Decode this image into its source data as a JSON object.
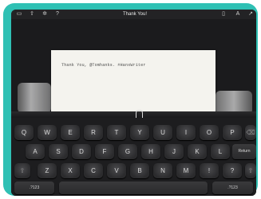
{
  "title": "Thank You!",
  "toolbar": {
    "left_icons": [
      "document-icon",
      "share-icon",
      "gear-icon",
      "help-icon"
    ],
    "right_icons": [
      "clipboard-icon",
      "font-icon",
      "export-icon"
    ]
  },
  "paper": {
    "text": "Thank You, @Tomhanks. #HanxWriter"
  },
  "keyboard": {
    "row1": [
      "Q",
      "W",
      "E",
      "R",
      "T",
      "Y",
      "U",
      "I",
      "O",
      "P"
    ],
    "row2": [
      "A",
      "S",
      "D",
      "F",
      "G",
      "H",
      "J",
      "K",
      "L"
    ],
    "row3": [
      "Z",
      "X",
      "C",
      "V",
      "B",
      "N",
      "M",
      "!",
      "?"
    ],
    "return_label": "Return",
    "numbers_left_label": ".?123",
    "numbers_right_label": ".?123"
  },
  "colors": {
    "bezel": "#2fc0b4",
    "screen": "#1b1b1d",
    "paper": "#f4f3ee"
  }
}
